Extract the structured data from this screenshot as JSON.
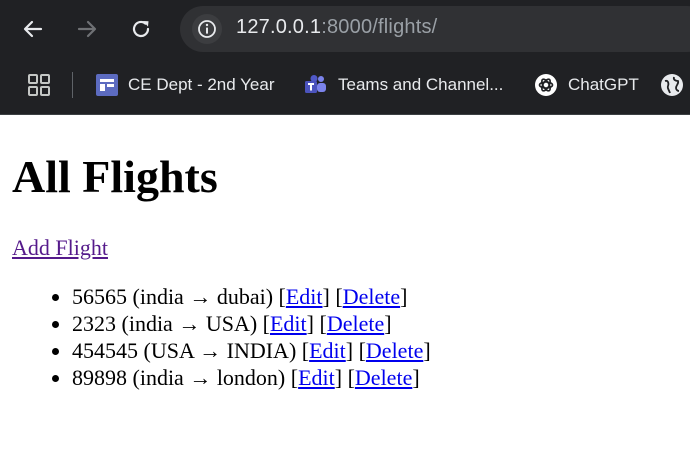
{
  "browser": {
    "url_host": "127.0.0.1",
    "url_rest": ":8000/flights/",
    "bookmarks": [
      {
        "label": "CE Dept - 2nd Year",
        "icon": "classroom-icon"
      },
      {
        "label": "Teams and Channel...",
        "icon": "teams-icon"
      },
      {
        "label": "ChatGPT",
        "icon": "chatgpt-icon"
      }
    ]
  },
  "page": {
    "title": "All Flights",
    "add_link": "Add Flight",
    "flights": [
      {
        "text": "56565 (india → dubai) [",
        "mid": "] [",
        "end": "]"
      },
      {
        "text": "2323 (india → USA) [",
        "mid": "] [",
        "end": "]"
      },
      {
        "text": "454545 (USA → INDIA) [",
        "mid": "] [",
        "end": "]"
      },
      {
        "text": "89898 (india → london) [",
        "mid": "] [",
        "end": "]"
      }
    ],
    "edit_label": "Edit",
    "delete_label": "Delete"
  },
  "colors": {
    "chrome_bg": "#202124",
    "omnibox_bg": "#303134",
    "link": "#0000ee",
    "visited_link": "#551a8b"
  }
}
